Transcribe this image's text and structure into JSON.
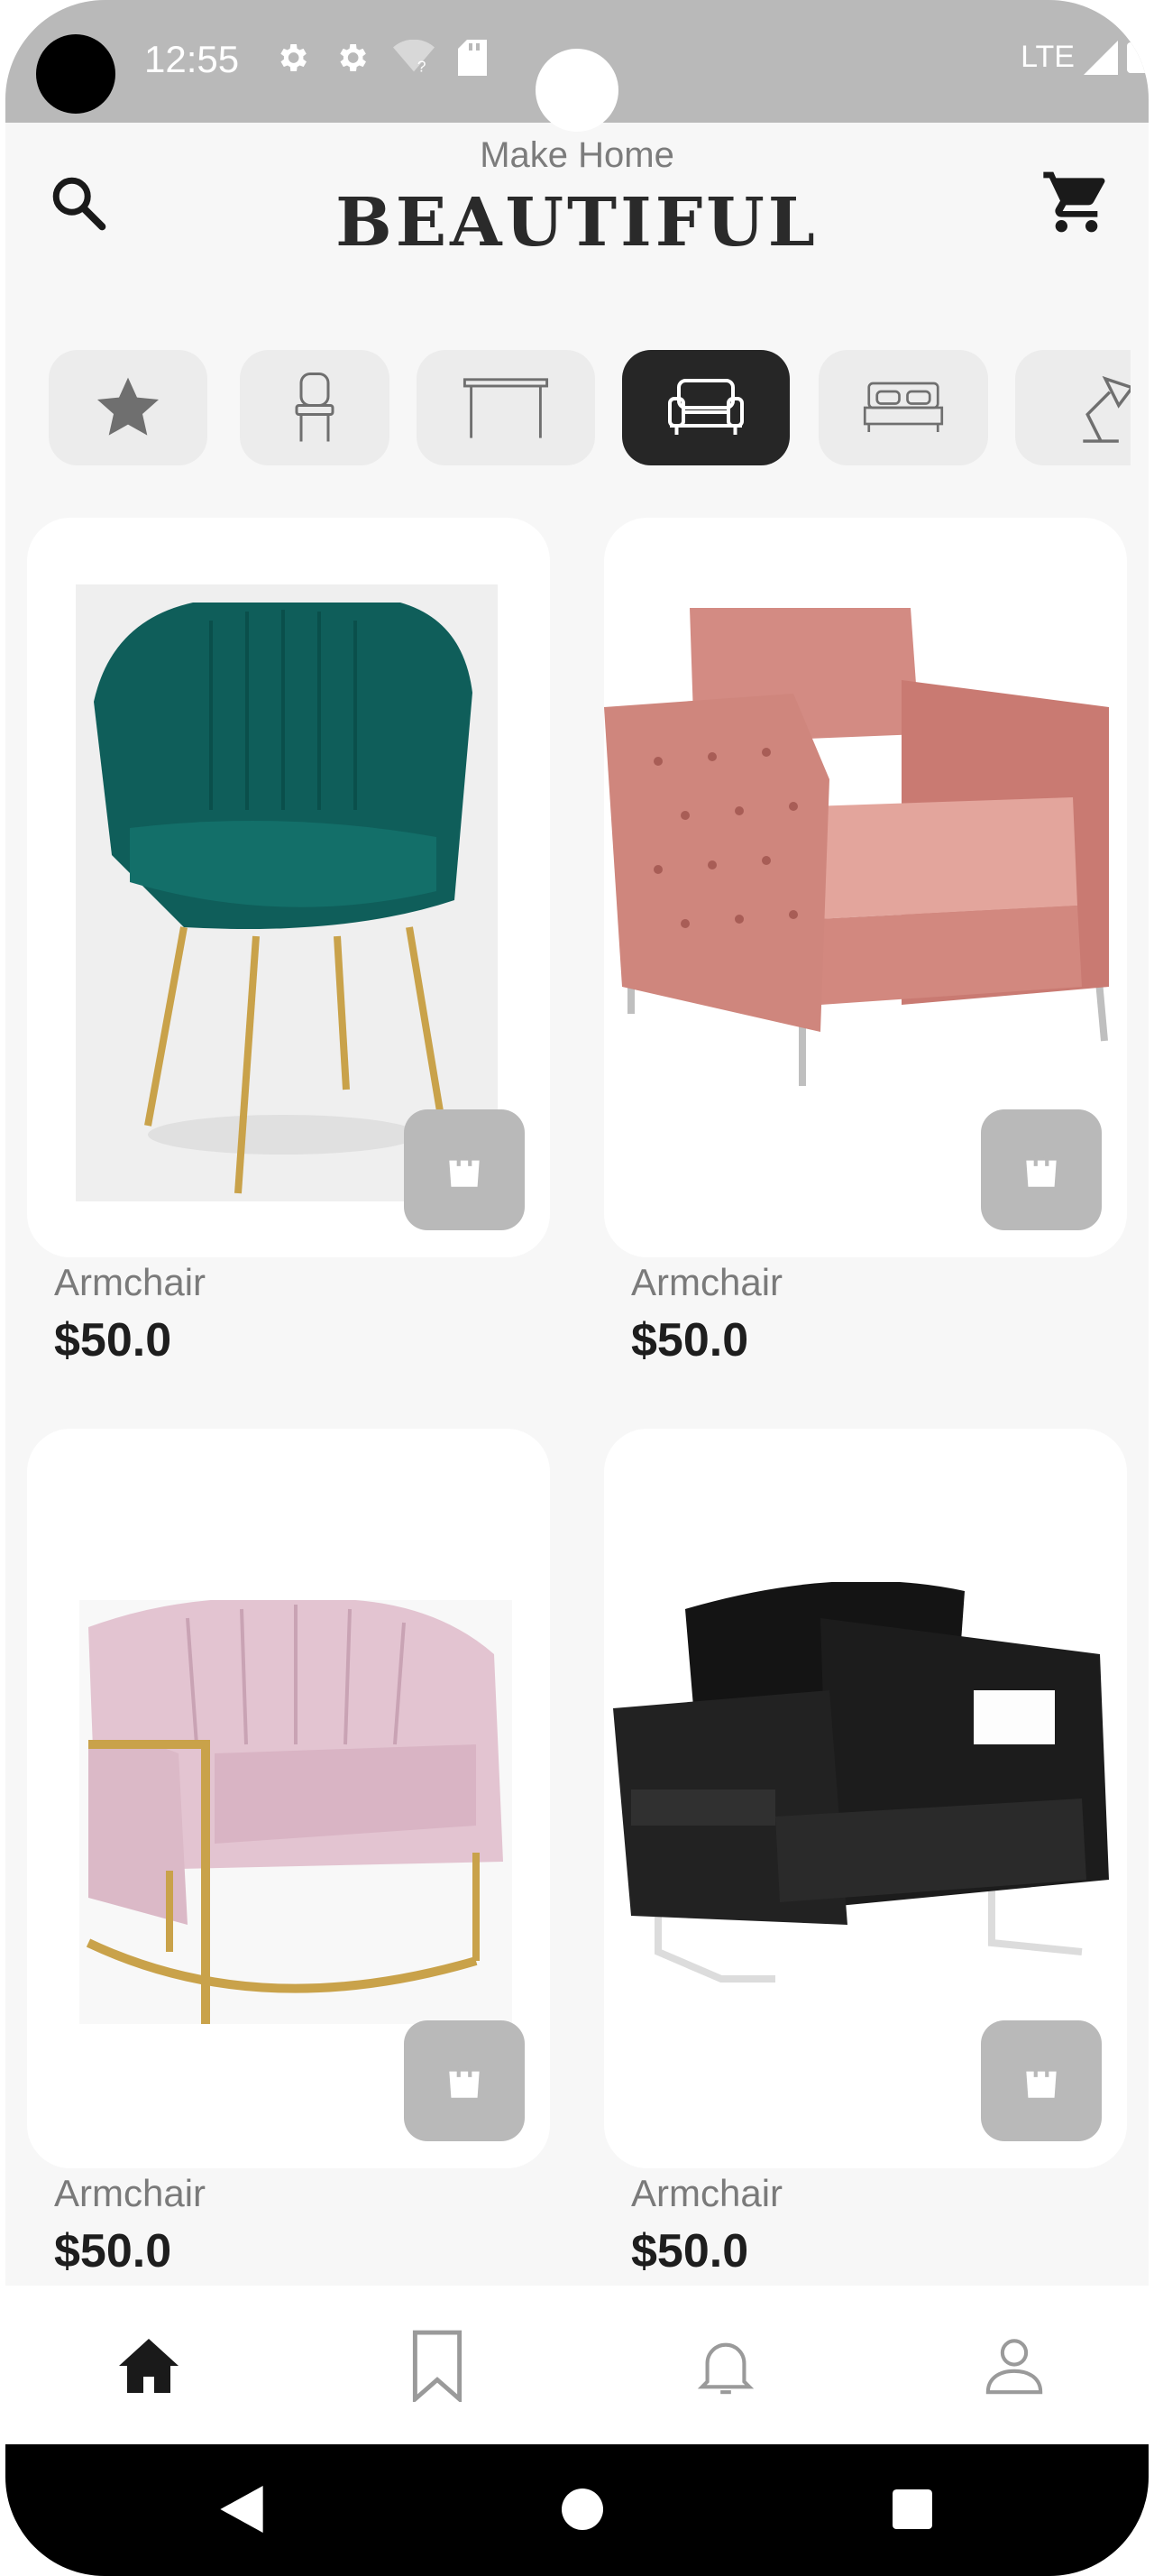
{
  "status_bar": {
    "time": "12:55",
    "network": "LTE",
    "icons": [
      "gear-icon",
      "gear-icon",
      "wifi-off-icon",
      "sd-card-icon",
      "signal-icon",
      "battery-icon"
    ]
  },
  "header": {
    "subtitle": "Make Home",
    "title": "BEAUTIFUL",
    "left_icon": "search-icon",
    "right_icon": "cart-icon"
  },
  "categories": [
    {
      "icon": "star-icon",
      "active": false
    },
    {
      "icon": "chair-icon",
      "active": false
    },
    {
      "icon": "table-icon",
      "active": false
    },
    {
      "icon": "sofa-icon",
      "active": true
    },
    {
      "icon": "bed-icon",
      "active": false
    },
    {
      "icon": "lamp-icon",
      "active": false
    }
  ],
  "products": [
    {
      "name": "Armchair",
      "price": "$50.0",
      "image": "teal velvet armchair"
    },
    {
      "name": "Armchair",
      "price": "$50.0",
      "image": "pink tufted armchair"
    },
    {
      "name": "Armchair",
      "price": "$50.0",
      "image": "lilac barrel armchair"
    },
    {
      "name": "Armchair",
      "price": "$50.0",
      "image": "black velvet armchair"
    }
  ],
  "bottom_nav": [
    {
      "icon": "home-icon",
      "active": true
    },
    {
      "icon": "bookmark-icon",
      "active": false
    },
    {
      "icon": "bell-icon",
      "active": false
    },
    {
      "icon": "profile-icon",
      "active": false
    }
  ],
  "colors": {
    "background": "#f7f7f7",
    "status_bar": "#b9b9b9",
    "active_category": "#262626",
    "inactive_category": "#ececec",
    "bag_button": "#b9b9b9"
  }
}
